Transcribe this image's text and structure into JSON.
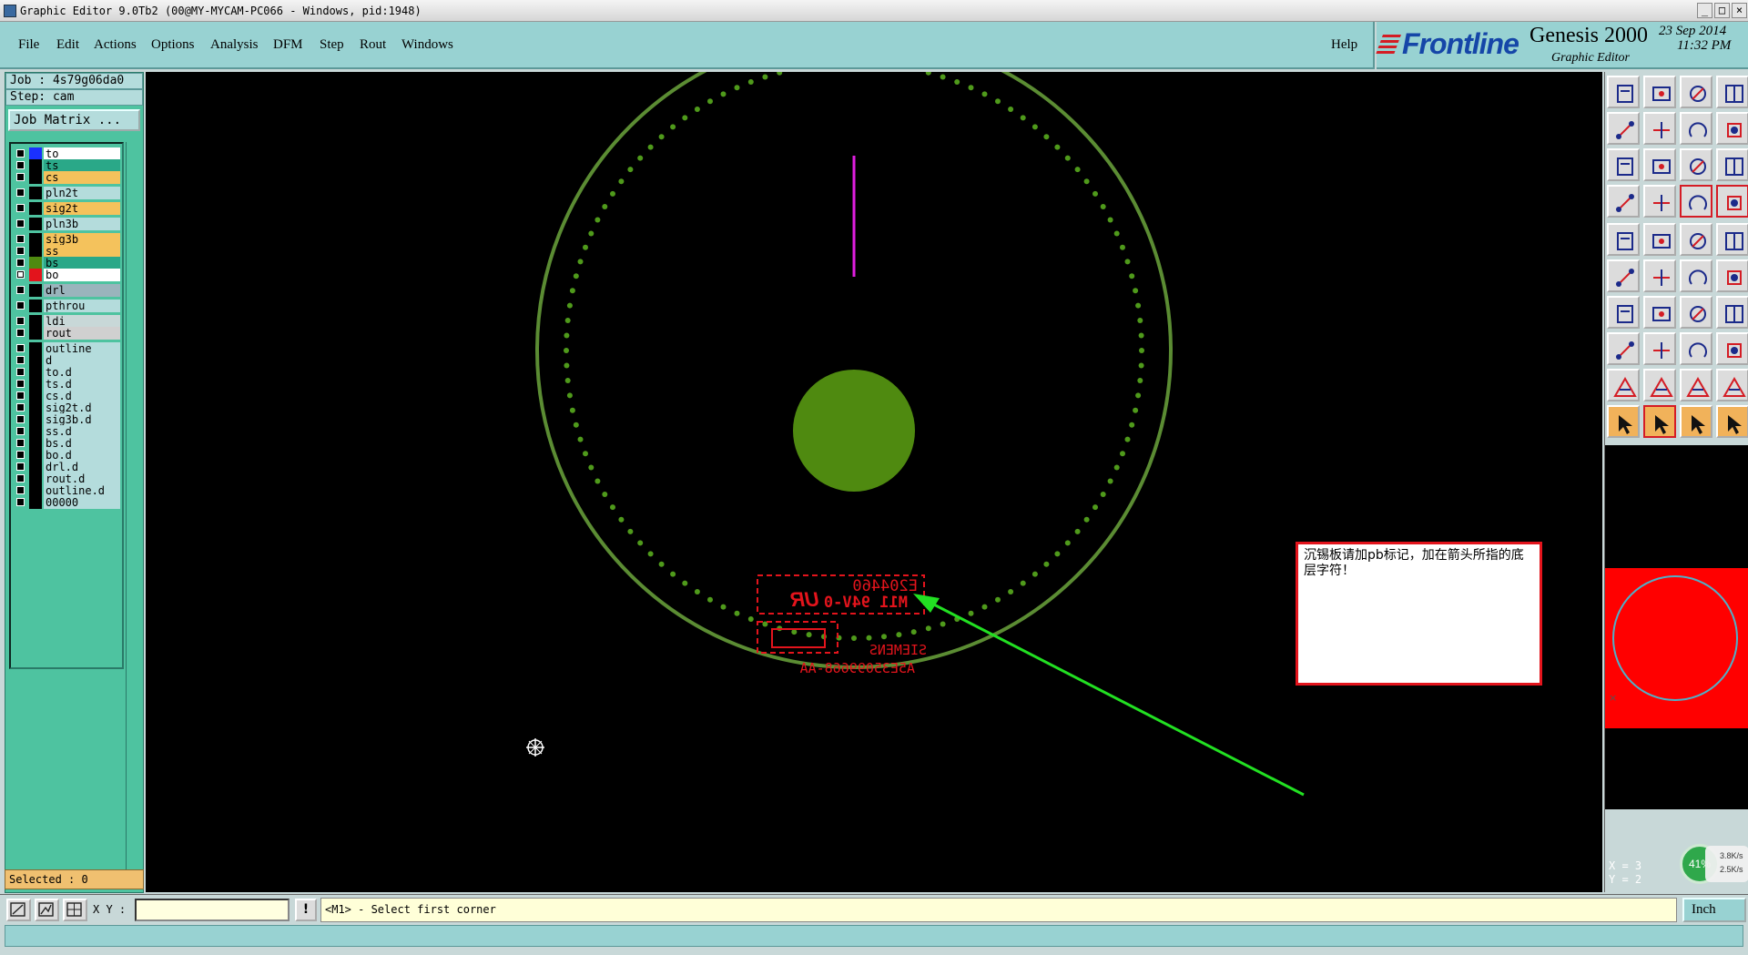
{
  "window": {
    "title": "Graphic Editor 9.0Tb2 (00@MY-MYCAM-PC066 - Windows, pid:1948)",
    "controls": [
      "_",
      "□",
      "×"
    ]
  },
  "menu": {
    "items": [
      "File",
      "Edit",
      "Actions",
      "Options",
      "Analysis",
      "DFM",
      "Step",
      "Rout",
      "Windows"
    ],
    "help": "Help"
  },
  "brand": {
    "logo": "Frontline",
    "product": "Genesis 2000",
    "subtitle": "Graphic Editor",
    "date": "23 Sep 2014",
    "time": "11:32 PM"
  },
  "job": {
    "job_line": "Job : 4s79g06da0",
    "step_line": "Step: cam",
    "matrix_button": "Job Matrix ..."
  },
  "layers": [
    {
      "name": "to",
      "bg": "#ffffff",
      "swatch": "#1a30ff",
      "checked": false
    },
    {
      "name": "ts",
      "bg": "#2aa888",
      "swatch": "#000000",
      "checked": false
    },
    {
      "name": "cs",
      "bg": "#f4c25c",
      "swatch": "#000000",
      "checked": false
    },
    {
      "name": "pln2t",
      "bg": "#b4dcdc",
      "swatch": "#000000",
      "checked": false
    },
    {
      "name": "sig2t",
      "bg": "#f4c25c",
      "swatch": "#000000",
      "checked": false
    },
    {
      "name": "pln3b",
      "bg": "#b4dcdc",
      "swatch": "#000000",
      "checked": false
    },
    {
      "name": "sig3b",
      "bg": "#f4c25c",
      "swatch": "#000000",
      "checked": false
    },
    {
      "name": "ss",
      "bg": "#f4c25c",
      "swatch": "#000000",
      "checked": false
    },
    {
      "name": "bs",
      "bg": "#2aa888",
      "swatch": "#4f8a10",
      "checked": false
    },
    {
      "name": "bo",
      "bg": "#ffffff",
      "swatch": "#e3141c",
      "checked": true
    },
    {
      "name": "drl",
      "bg": "#9ab4bc",
      "swatch": "#000000",
      "checked": false
    },
    {
      "name": "pthrou",
      "bg": "#b4dcdc",
      "swatch": "#000000",
      "checked": false
    },
    {
      "name": "ldi",
      "bg": "#c8d8d8",
      "swatch": "#000000",
      "checked": false
    },
    {
      "name": "rout",
      "bg": "#d0d0d0",
      "swatch": "#000000",
      "checked": false
    },
    {
      "name": "outline",
      "bg": "#b4dcdc",
      "swatch": "#000000",
      "checked": false
    },
    {
      "name": "d",
      "bg": "#b4dcdc",
      "swatch": "#000000",
      "checked": false
    },
    {
      "name": "to.d",
      "bg": "#b4dcdc",
      "swatch": "#000000",
      "checked": false
    },
    {
      "name": "ts.d",
      "bg": "#b4dcdc",
      "swatch": "#000000",
      "checked": false
    },
    {
      "name": "cs.d",
      "bg": "#b4dcdc",
      "swatch": "#000000",
      "checked": false
    },
    {
      "name": "sig2t.d",
      "bg": "#b4dcdc",
      "swatch": "#000000",
      "checked": false
    },
    {
      "name": "sig3b.d",
      "bg": "#b4dcdc",
      "swatch": "#000000",
      "checked": false
    },
    {
      "name": "ss.d",
      "bg": "#b4dcdc",
      "swatch": "#000000",
      "checked": false
    },
    {
      "name": "bs.d",
      "bg": "#b4dcdc",
      "swatch": "#000000",
      "checked": false
    },
    {
      "name": "bo.d",
      "bg": "#b4dcdc",
      "swatch": "#000000",
      "checked": false
    },
    {
      "name": "drl.d",
      "bg": "#b4dcdc",
      "swatch": "#000000",
      "checked": false
    },
    {
      "name": "rout.d",
      "bg": "#b4dcdc",
      "swatch": "#000000",
      "checked": false
    },
    {
      "name": "outline.d",
      "bg": "#b4dcdc",
      "swatch": "#000000",
      "checked": false
    },
    {
      "name": "00000",
      "bg": "#b4dcdc",
      "swatch": "#000000",
      "checked": false
    }
  ],
  "selected_label": "Selected : 0",
  "canvas": {
    "silkscreen_text": [
      "E204460",
      "M11 94V-0",
      "SIEMENS",
      "A5E35099668-AA"
    ],
    "ul_mark": "UR",
    "annotation": "沉锡板请加pb标记，加在箭头所指的底层字符！",
    "colors": {
      "outline": "#5b8c33",
      "dots": "#4f9a1b",
      "pad": "#4f8a10",
      "magenta_line": "#e01ee0",
      "silk": "#e3141c",
      "arrow": "#22e022"
    }
  },
  "toolbar_icons": [
    "open-icon",
    "save-icon",
    "home-icon",
    "window-icon",
    "prev-icon",
    "next-icon",
    "undo-icon",
    "snap-icon",
    "zoom-fit-icon",
    "pan-icon",
    "zoom-ratio-icon",
    "help-icon",
    "measure-icon",
    "grid-icon",
    "route-icon",
    "net-icon",
    "feature-icon",
    "shape-icon",
    "ruler-icon",
    "pad-icon",
    "connect-icon",
    "cross-icon",
    "link-icon",
    "link2-icon",
    "line-icon",
    "diagonal-icon",
    "arc-icon",
    "align-icon",
    "pad-add-icon",
    "line-add-icon",
    "dimension-icon",
    "group-icon",
    "triangle-icon",
    "triangle-edit-icon",
    "text-icon",
    "text-edit-icon",
    "pointer-icon",
    "select-icon",
    "rotate-icon",
    "route-select-icon"
  ],
  "coords": {
    "x": "X = 3",
    "y": "Y = 2"
  },
  "network": {
    "percent": "41%",
    "up": "3.8K/s",
    "down": "2.5K/s"
  },
  "status": {
    "xy_label": "X Y :",
    "xy_value": "",
    "bang": "!",
    "prompt": "<M1> - Select first corner",
    "units": "Inch"
  }
}
